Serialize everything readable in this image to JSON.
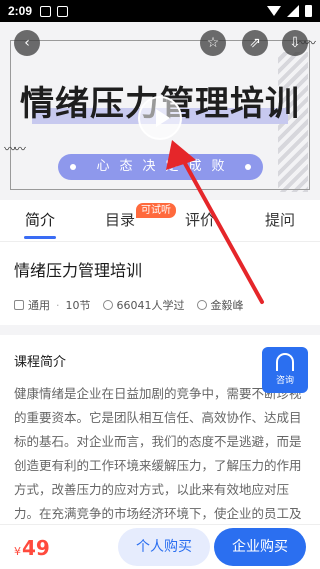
{
  "status_bar": {
    "time": "2:09"
  },
  "banner": {
    "title": "情绪压力管理培训",
    "slogan": "心态决定成败"
  },
  "tabs": [
    {
      "label": "简介",
      "active": true
    },
    {
      "label": "目录",
      "active": false
    },
    {
      "label": "评价",
      "active": false
    },
    {
      "label": "提问",
      "active": false
    }
  ],
  "trial_badge": "可试听",
  "course": {
    "title": "情绪压力管理培训",
    "level": "通用",
    "lessons": "10节",
    "learners": "66041人学过",
    "teacher": "金毅峰"
  },
  "intro": {
    "heading": "课程简介",
    "text": "健康情绪是企业在日益加剧的竞争中，需要不断珍视的重要资本。它是团队相互信任、高效协作、达成目标的基石。对企业而言，我们的态度不是逃避，而是创造更有利的工作环境来缓解压力，了解压力的作用方式，改善压力的应对方式，以此来有效地应对压力。在充满竞争的市场经济环境下，使企业的员工及"
  },
  "consult": {
    "label": "咨询"
  },
  "bottom": {
    "currency": "¥",
    "price": "49",
    "personal_buy": "个人购买",
    "corporate_buy": "企业购买"
  },
  "colors": {
    "accent": "#2b6ff0",
    "price": "#ff4a3d",
    "badge": "#ff6a3d",
    "arrow": "#e5262a"
  }
}
